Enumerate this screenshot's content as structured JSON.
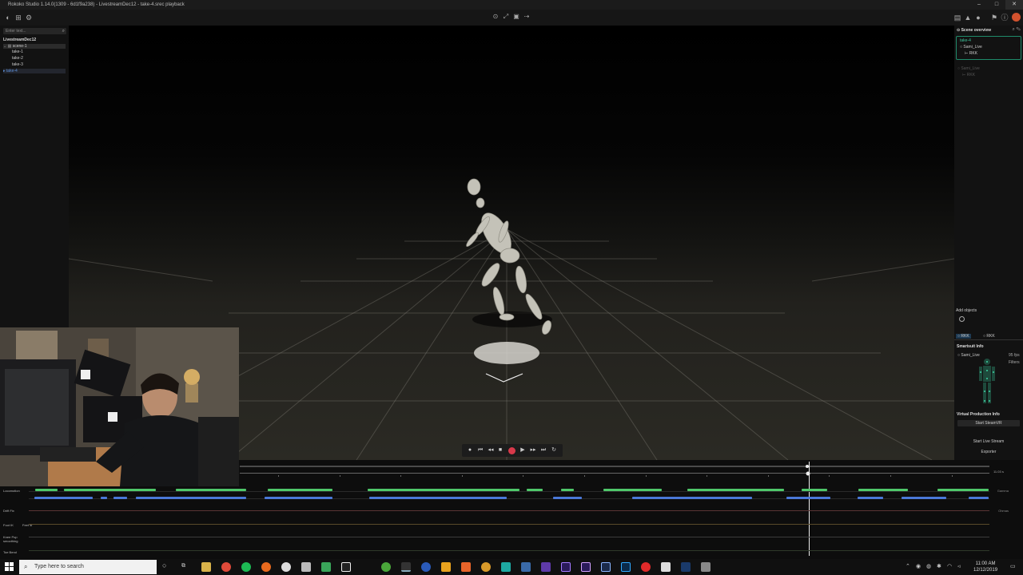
{
  "window": {
    "title": "Rokoko Studio 1.14.0(1309 - 6d1f9a238) - LivestreamDec12 - take-4.srec playback",
    "controls": [
      "–",
      "□",
      "✕"
    ]
  },
  "left_panel": {
    "search_placeholder": "Enter text...",
    "project": "LivestreamDec12",
    "scene": "scene-1",
    "takes": [
      "take-1",
      "take-2",
      "take-3",
      "take-4"
    ]
  },
  "right_panel": {
    "header": "Scene overview",
    "scene_items": [
      "take-4",
      "Sami_Live",
      "RKK"
    ],
    "dim_items": [
      "Sami_Live",
      "RKK"
    ],
    "add_objects": "Add objects",
    "tabs": [
      "RKK",
      "RKK"
    ],
    "smartsuit_info": "Smartsuit Info",
    "smartsuit_name": "Sami_Live",
    "fps": "95 fps",
    "filters": "Filters",
    "virtual_production": "Virtual Production Info",
    "start_steamvr": "Start SteamVR",
    "start_live_stream": "Start Live Stream",
    "exporter": "Exporter"
  },
  "timeline": {
    "tracks": [
      "Locomotion",
      "Drift Fix",
      "Foot IK",
      "Knee Pop smoothing",
      "Toe Bend"
    ],
    "foot_ik_sub": "Feet ⊕",
    "right_tags": [
      "Gamma",
      "Ohmas"
    ],
    "timecode": "11.03 s",
    "playhead_fraction": 0.737
  },
  "taskbar": {
    "search_placeholder": "Type here to search",
    "time": "11:00 AM",
    "date": "12/12/2019"
  }
}
